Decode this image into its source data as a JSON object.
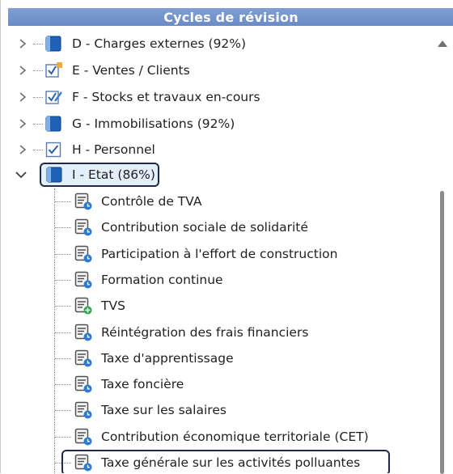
{
  "header": {
    "title": "Cycles de révision"
  },
  "cycles": [
    {
      "label": "D - Charges externes (92%)",
      "icon": "book-icon"
    },
    {
      "label": "E - Ventes / Clients",
      "icon": "check-note-icon"
    },
    {
      "label": "F - Stocks et travaux en-cours",
      "icon": "check-pen-icon"
    },
    {
      "label": "G - Immobilisations (92%)",
      "icon": "book-icon"
    },
    {
      "label": "H - Personnel",
      "icon": "checkbox-icon"
    },
    {
      "label": "I - Etat (86%)",
      "icon": "book-icon"
    }
  ],
  "subitems": [
    {
      "label": "Contrôle de TVA",
      "badge": "blue-clock"
    },
    {
      "label": "Contribution sociale de solidarité",
      "badge": "blue-clock"
    },
    {
      "label": "Participation à l'effort de construction",
      "badge": "blue-clock"
    },
    {
      "label": "Formation continue",
      "badge": "blue-clock"
    },
    {
      "label": "TVS",
      "badge": "green-plus"
    },
    {
      "label": "Réintégration des frais financiers",
      "badge": "blue-clock"
    },
    {
      "label": "Taxe d'apprentissage",
      "badge": "blue-clock"
    },
    {
      "label": "Taxe foncière",
      "badge": "blue-clock"
    },
    {
      "label": "Taxe sur les salaires",
      "badge": "blue-clock"
    },
    {
      "label": "Contribution économique territoriale (CET)",
      "badge": "blue-clock"
    },
    {
      "label": "Taxe générale sur les activités polluantes",
      "badge": "blue-clock"
    }
  ],
  "colors": {
    "header": "#7593cc",
    "book": "#1f63b8",
    "accent": "#1f2a4a"
  }
}
